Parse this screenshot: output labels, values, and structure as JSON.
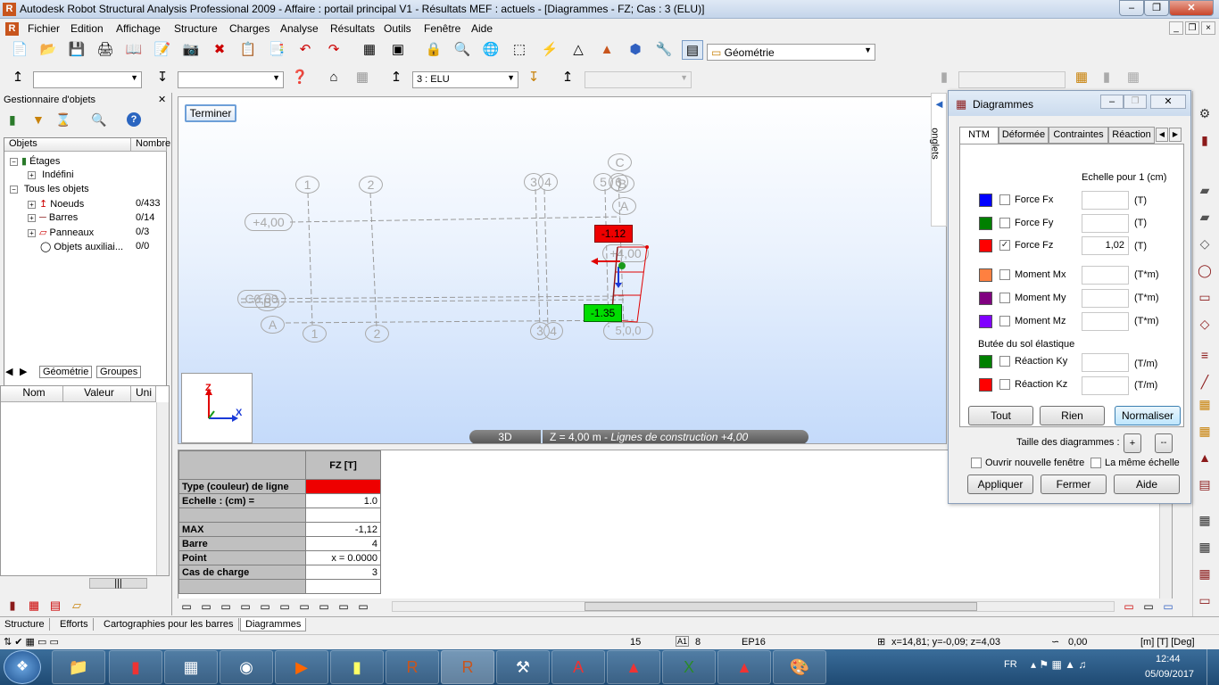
{
  "window": {
    "title": "Autodesk Robot Structural Analysis Professional 2009 - Affaire : portail principal V1 - Résultats MEF : actuels - [Diagrammes - FZ; Cas : 3 (ELU)]",
    "app_icon": "R"
  },
  "menu": [
    "Fichier",
    "Edition",
    "Affichage",
    "Structure",
    "Charges",
    "Analyse",
    "Résultats",
    "Outils",
    "Fenêtre",
    "Aide"
  ],
  "toolbar": {
    "view_combo": "Géométrie",
    "case_combo": "3 : ELU"
  },
  "object_manager": {
    "title": "Gestionnaire d'objets",
    "col_objects": "Objets",
    "col_number": "Nombre",
    "tree": [
      {
        "label": "Étages",
        "count": ""
      },
      {
        "label": "Indéfini",
        "count": ""
      },
      {
        "label": "Tous les objets",
        "count": ""
      },
      {
        "label": "Noeuds",
        "count": "0/433"
      },
      {
        "label": "Barres",
        "count": "0/14"
      },
      {
        "label": "Panneaux",
        "count": "0/3"
      },
      {
        "label": "Objets auxiliai...",
        "count": "0/0"
      }
    ],
    "tabs": [
      "Géométrie",
      "Groupes"
    ],
    "props_headers": [
      "Nom",
      "Valeur",
      "Uni"
    ]
  },
  "viewport": {
    "terminer": "Terminer",
    "mode_3d": "3D",
    "status": "Z = 4,00 m - ",
    "status_italic": "Lignes de construction +4,00",
    "value_top": "-1.12",
    "value_bottom": "-1.35",
    "labels_top": [
      "1",
      "2",
      "3",
      "4",
      "5",
      "6",
      "C",
      "B",
      "A"
    ],
    "level_top": "+4,00",
    "level_mid": "+4,00",
    "labels_bottom": [
      "1",
      "2",
      "3",
      "4",
      "5",
      "6",
      "A"
    ],
    "left_overlap": "C",
    "left_b": "B",
    "left_tag": "0,00",
    "right_overlap": "5,0,0",
    "axis_x": "X",
    "axis_z": "Z"
  },
  "table": {
    "column_header": "FZ [T]",
    "rows": [
      {
        "label": "Type (couleur) de ligne",
        "value": ""
      },
      {
        "label": "Echelle : (cm) =",
        "value": "1.0"
      },
      {
        "label": "",
        "value": ""
      },
      {
        "label": "MAX",
        "value": "-1,12"
      },
      {
        "label": "Barre",
        "value": "4"
      },
      {
        "label": "Point",
        "value": "x = 0.0000"
      },
      {
        "label": "Cas de charge",
        "value": "3"
      },
      {
        "label": "",
        "value": ""
      }
    ]
  },
  "dialog": {
    "title": "Diagrammes",
    "side_tab": "onglets",
    "tabs": [
      "NTM",
      "Déformée",
      "Contraintes",
      "Réaction"
    ],
    "scale_label": "Echelle pour 1  (cm)",
    "forces": [
      {
        "name": "Force Fx",
        "color": "#0000ff",
        "checked": false,
        "value": "",
        "unit": "(T)"
      },
      {
        "name": "Force Fy",
        "color": "#008000",
        "checked": false,
        "value": "",
        "unit": "(T)"
      },
      {
        "name": "Force Fz",
        "color": "#ff0000",
        "checked": true,
        "value": "1,02",
        "unit": "(T)"
      },
      {
        "name": "Moment Mx",
        "color": "#ff8040",
        "checked": false,
        "value": "",
        "unit": "(T*m)"
      },
      {
        "name": "Moment My",
        "color": "#800080",
        "checked": false,
        "value": "",
        "unit": "(T*m)"
      },
      {
        "name": "Moment Mz",
        "color": "#8000ff",
        "checked": false,
        "value": "",
        "unit": "(T*m)"
      }
    ],
    "soil_label": "Butée du sol élastique",
    "reactions": [
      {
        "name": "Réaction Ky",
        "color": "#008000",
        "checked": false,
        "value": "",
        "unit": "(T/m)"
      },
      {
        "name": "Réaction Kz",
        "color": "#ff0000",
        "checked": false,
        "value": "",
        "unit": "(T/m)"
      }
    ],
    "btn_all": "Tout",
    "btn_none": "Rien",
    "btn_normalize": "Normaliser",
    "size_label": "Taille des diagrammes :",
    "plus": "+",
    "minus": "--",
    "new_window": "Ouvrir nouvelle fenêtre",
    "same_scale": "La même échelle",
    "btn_apply": "Appliquer",
    "btn_close": "Fermer",
    "btn_help": "Aide"
  },
  "bottom_tabs": [
    "Structure",
    "Efforts",
    "Cartographies pour les barres",
    "Diagrammes"
  ],
  "status": {
    "count": "15",
    "nodes": "8",
    "section": "EP16",
    "coords": "x=14,81; y=-0,09; z=4,03",
    "angle": "0,00",
    "units": "[m] [T] [Deg]"
  },
  "tray": {
    "lang": "FR",
    "time": "12:44",
    "date": "05/09/2017"
  }
}
